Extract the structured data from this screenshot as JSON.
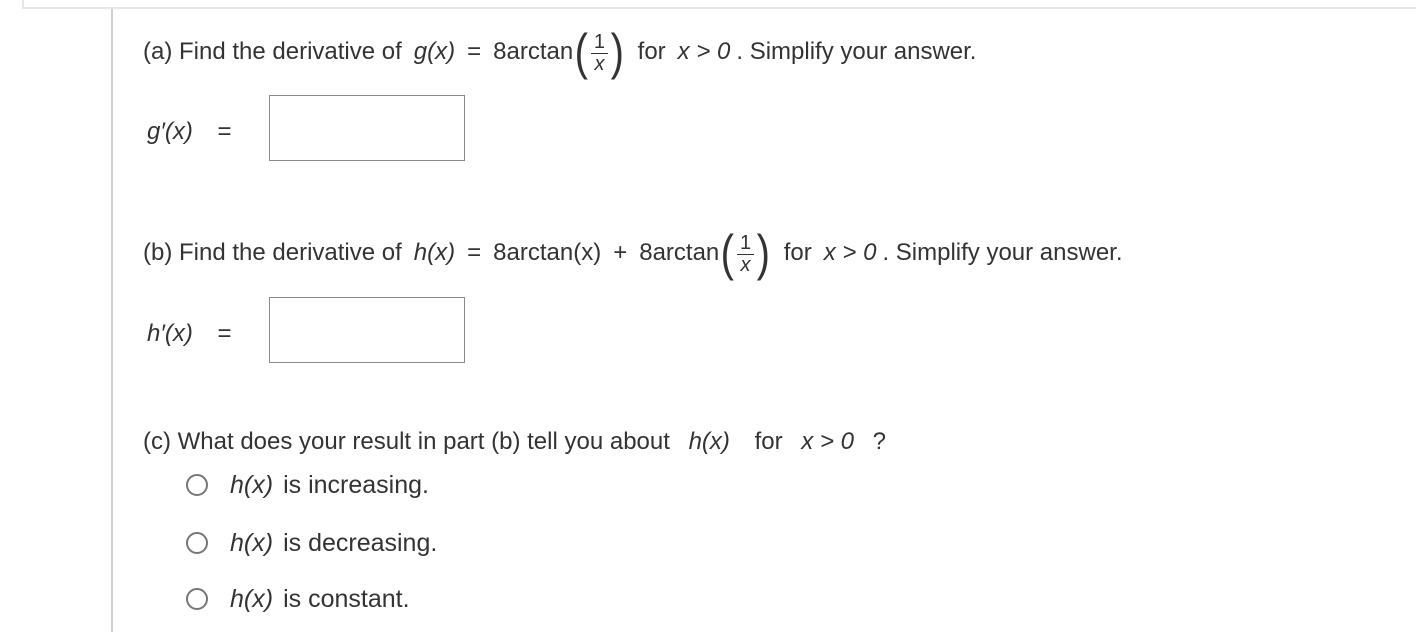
{
  "part_a": {
    "prefix": "(a) Find the derivative of",
    "func": "g(x)",
    "eq": "=",
    "coef": "8arctan",
    "frac_num": "1",
    "frac_den": "x",
    "for_text": "for",
    "cond": "x > 0",
    "suffix": ". Simplify your answer.",
    "answer_label": "g′(x)",
    "answer_eq": "=",
    "answer_value": ""
  },
  "part_b": {
    "prefix": "(b) Find the derivative of",
    "func": "h(x)",
    "eq": "=",
    "term1": "8arctan(x)",
    "plus": "+",
    "coef": "8arctan",
    "frac_num": "1",
    "frac_den": "x",
    "for_text": "for",
    "cond": "x > 0",
    "suffix": ". Simplify your answer.",
    "answer_label": "h′(x)",
    "answer_eq": "=",
    "answer_value": ""
  },
  "part_c": {
    "prefix": "(c) What does your result in part (b) tell you about",
    "func": "h(x)",
    "for_text": "for",
    "cond": "x > 0",
    "qmark": "?",
    "options": [
      {
        "func": "h(x)",
        "text": "is increasing."
      },
      {
        "func": "h(x)",
        "text": "is decreasing."
      },
      {
        "func": "h(x)",
        "text": "is constant."
      }
    ]
  }
}
